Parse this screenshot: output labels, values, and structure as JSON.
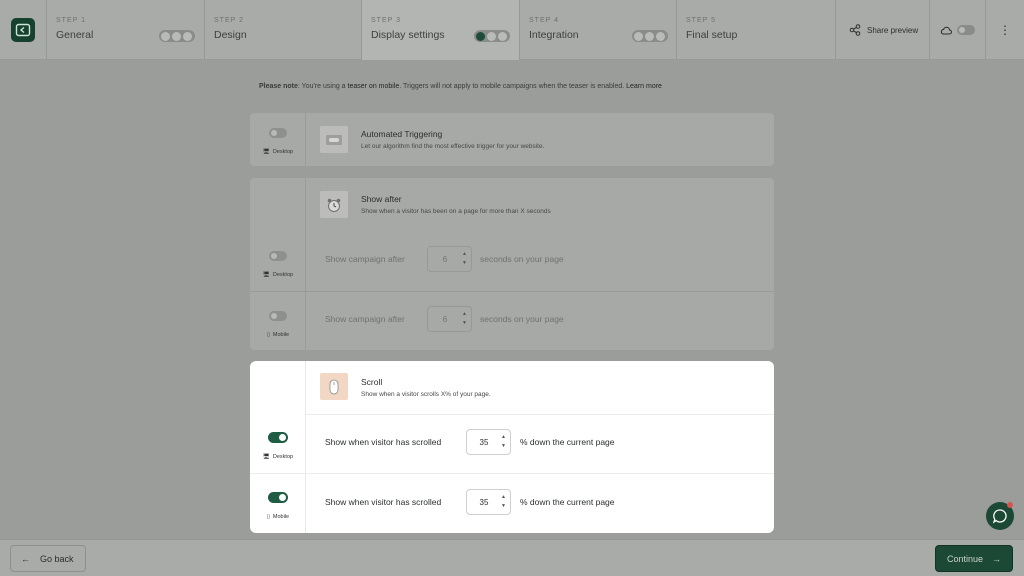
{
  "header": {
    "steps": [
      {
        "kicker": "STEP 1",
        "title": "General",
        "state": "partial"
      },
      {
        "kicker": "STEP 2",
        "title": "Design"
      },
      {
        "kicker": "STEP 3",
        "title": "Display settings",
        "state": "active"
      },
      {
        "kicker": "STEP 4",
        "title": "Integration",
        "state": "partial"
      },
      {
        "kicker": "STEP 5",
        "title": "Final setup"
      }
    ],
    "share_label": "Share preview"
  },
  "notice": {
    "prefix": "Please note",
    "text_1": ": You're using a ",
    "highlight": "teaser on mobile",
    "text_2": ". Triggers will not apply to mobile campaigns when the teaser is enabled. ",
    "link": "Learn more"
  },
  "cards": {
    "automated": {
      "title": "Automated Triggering",
      "desc": "Let our algorithm find the most effective trigger for your website.",
      "device": "Desktop"
    },
    "show_after": {
      "title": "Show after",
      "desc": "Show when a visitor has been on a page for more than X seconds",
      "rows": [
        {
          "device": "Desktop",
          "label": "Show campaign after",
          "value": "6",
          "suffix": "seconds on your page"
        },
        {
          "device": "Mobile",
          "label": "Show campaign after",
          "value": "6",
          "suffix": "seconds on your page"
        }
      ]
    },
    "scroll": {
      "title": "Scroll",
      "desc": "Show when a visitor scrolls X% of your page.",
      "rows": [
        {
          "device": "Desktop",
          "label": "Show when visitor has scrolled",
          "value": "35",
          "suffix": "% down the current page"
        },
        {
          "device": "Mobile",
          "label": "Show when visitor has scrolled",
          "value": "35",
          "suffix": "% down the current page"
        }
      ]
    }
  },
  "footer": {
    "back_label": "Go back",
    "continue_label": "Continue"
  },
  "colors": {
    "brand": "#1c4935",
    "toggle_on": "#1f5c44",
    "overlay_bg": "#9b9d9a",
    "scroll_thumb": "#f2d7c4"
  }
}
